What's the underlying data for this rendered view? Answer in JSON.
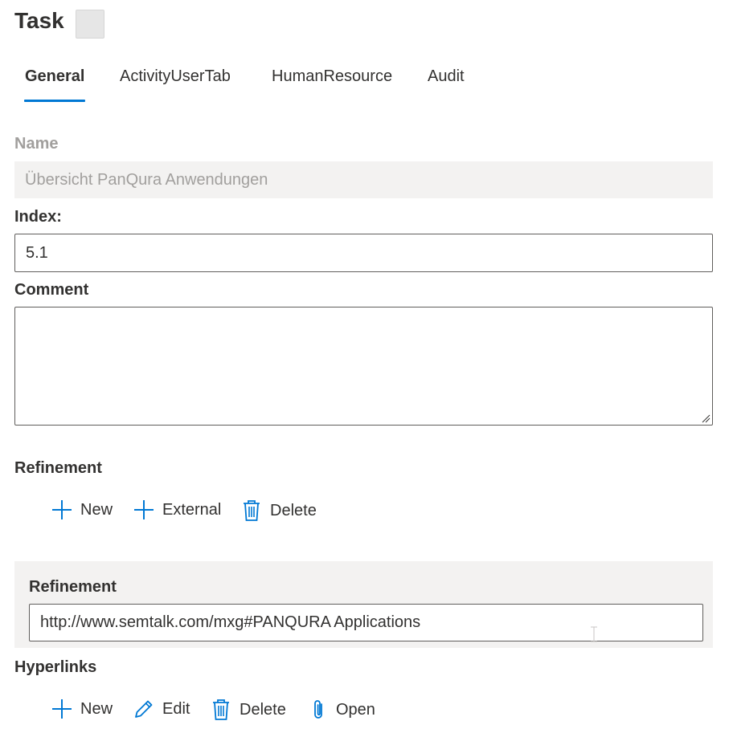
{
  "header": {
    "title": "Task"
  },
  "tabs": [
    {
      "label": "General",
      "active": true
    },
    {
      "label": "ActivityUserTab",
      "active": false
    },
    {
      "label": "HumanResource",
      "active": false
    },
    {
      "label": "Audit",
      "active": false
    }
  ],
  "form": {
    "name": {
      "label": "Name",
      "value": "Übersicht PanQura Anwendungen"
    },
    "index": {
      "label": "Index:",
      "value": "5.1"
    },
    "comment": {
      "label": "Comment",
      "value": ""
    }
  },
  "refinement": {
    "section_label": "Refinement",
    "commands": {
      "new": "New",
      "external": "External",
      "delete": "Delete"
    },
    "panel_label": "Refinement",
    "value": "http://www.semtalk.com/mxg#PANQURA Applications"
  },
  "hyperlinks": {
    "section_label": "Hyperlinks",
    "commands": {
      "new": "New",
      "edit": "Edit",
      "delete": "Delete",
      "open": "Open"
    }
  },
  "colors": {
    "accent": "#0078d4",
    "text": "#323130",
    "disabled_text": "#a19f9d",
    "disabled_bg": "#f3f2f1"
  },
  "icons": [
    "add-icon",
    "delete-icon",
    "edit-icon",
    "attach-icon"
  ]
}
